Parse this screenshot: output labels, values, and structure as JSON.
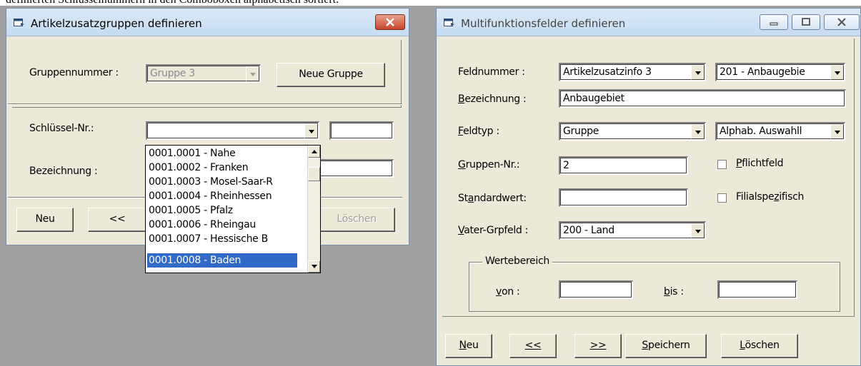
{
  "background_caption": "definierten Schlüsselnummern in den Comboboxen alphabetisch sortiert.",
  "window1": {
    "title": "Artikelzusatzgruppen definieren",
    "group_label": "Gruppennummer :",
    "group_value": "Gruppe 3",
    "new_group_button": "Neue Gruppe",
    "key_label": "Schlüssel-Nr.:",
    "key_value": "",
    "name_label": "Bezeichnung :",
    "buttons": {
      "new": "Neu",
      "prev": "<<",
      "delete": "Löschen"
    },
    "dropdown_items": [
      "0001.0001 - Nahe",
      "0001.0002 - Franken",
      "0001.0003 - Mosel-Saar-R",
      "0001.0004 - Rheinhessen",
      "0001.0005 - Pfalz",
      "0001.0006 - Rheingau",
      "0001.0007 - Hessische B",
      "0001.0008 - Baden"
    ],
    "selected_index": 7
  },
  "window2": {
    "title": "Multifunktionsfelder definieren",
    "field_number_label": "Feldnummer :",
    "field_number_value": "Artikelzusatzinfo 3",
    "field_number_value2": "201 - Anbaugebie",
    "name_label": "Bezeichnung :",
    "name_value": "Anbaugebiet",
    "type_label": "Feldtyp :",
    "type_value": "Gruppe",
    "type_value2": "Alphab. Auswahll",
    "group_nr_label": "Gruppen-Nr.:",
    "group_nr_value": "2",
    "required_label": "Pflichtfeld",
    "default_label": "Standardwert:",
    "default_value": "",
    "branch_label": "Filialspezifisch",
    "parent_label": "Vater-Grpfeld :",
    "parent_value": "200 - Land",
    "range_label": "Wertebereich",
    "from_label": "von :",
    "to_label": "bis :",
    "buttons": {
      "new": "Neu",
      "prev": "<<",
      "next": ">>",
      "save": "Speichern",
      "delete": "Löschen"
    }
  },
  "colors": {
    "selection": "#3169c6",
    "face": "#ece9d8",
    "desktop": "#a0a0a0"
  }
}
